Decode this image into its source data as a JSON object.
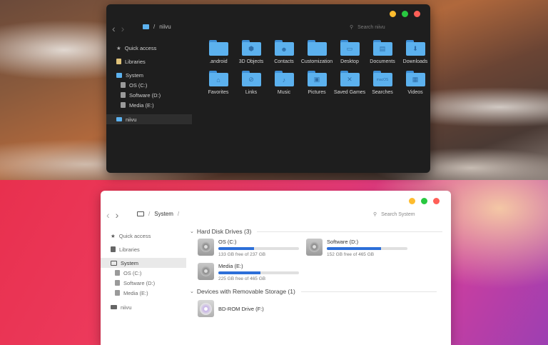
{
  "colors": {
    "close": "#ff5f57",
    "minimize": "#febc2e",
    "maximize": "#28c840",
    "folder": "#5cb1ee",
    "progress": "#2d6fd8"
  },
  "dark": {
    "breadcrumb": {
      "sep": "/",
      "path": "niivu"
    },
    "search_placeholder": "Search niivu",
    "sidebar": [
      {
        "label": "Quick access",
        "icon": "star-icon"
      },
      {
        "label": "Libraries",
        "icon": "library-icon"
      },
      {
        "label": "System",
        "icon": "monitor-icon"
      },
      {
        "label": "OS (C:)",
        "icon": "drive-icon"
      },
      {
        "label": "Software (D:)",
        "icon": "drive-icon"
      },
      {
        "label": "Media (E:)",
        "icon": "drive-icon"
      },
      {
        "label": "niivu",
        "icon": "folder-icon"
      }
    ],
    "folders": [
      {
        "label": ".android",
        "glyph": ""
      },
      {
        "label": "3D Objects",
        "glyph": "⬢"
      },
      {
        "label": "Contacts",
        "glyph": "☻"
      },
      {
        "label": "Customization",
        "glyph": ""
      },
      {
        "label": "Desktop",
        "glyph": "▭"
      },
      {
        "label": "Documents",
        "glyph": "▤"
      },
      {
        "label": "Downloads",
        "glyph": "⬇"
      },
      {
        "label": "Favorites",
        "glyph": "⌂"
      },
      {
        "label": "Links",
        "glyph": "⊘"
      },
      {
        "label": "Music",
        "glyph": "♪"
      },
      {
        "label": "Pictures",
        "glyph": "▣"
      },
      {
        "label": "Saved Games",
        "glyph": "✕"
      },
      {
        "label": "Searches",
        "glyph": "macOS"
      },
      {
        "label": "Videos",
        "glyph": "▦"
      }
    ]
  },
  "light": {
    "breadcrumb": {
      "path": "System",
      "sep": "/"
    },
    "search_placeholder": "Search System",
    "sidebar": [
      {
        "label": "Quick access",
        "icon": "star-icon"
      },
      {
        "label": "Libraries",
        "icon": "library-icon"
      },
      {
        "label": "System",
        "icon": "monitor-icon"
      },
      {
        "label": "OS (C:)",
        "icon": "drive-icon"
      },
      {
        "label": "Software (D:)",
        "icon": "drive-icon"
      },
      {
        "label": "Media (E:)",
        "icon": "drive-icon"
      },
      {
        "label": "niivu",
        "icon": "mail-icon"
      }
    ],
    "hard_disk_header": "Hard Disk Drives (3)",
    "removable_header": "Devices with Removable Storage (1)",
    "drives": [
      {
        "name": "OS (C:)",
        "free": "133 GB free of 237 GB",
        "used_fraction": 0.44
      },
      {
        "name": "Software (D:)",
        "free": "152 GB free of 465 GB",
        "used_fraction": 0.67
      },
      {
        "name": "Media (E:)",
        "free": "225 GB free of 465 GB",
        "used_fraction": 0.52
      }
    ],
    "removable": [
      {
        "name": "BD-ROM Drive (F:)"
      }
    ]
  }
}
